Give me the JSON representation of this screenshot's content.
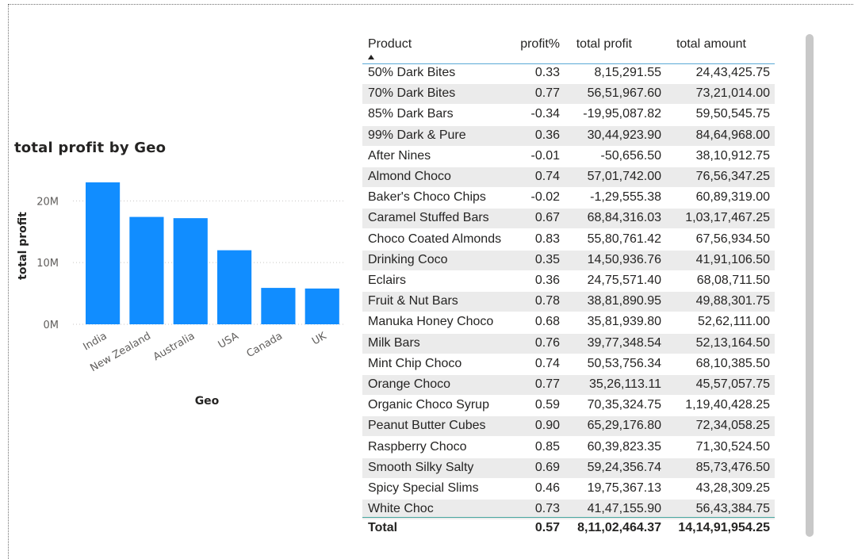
{
  "chart_data": {
    "type": "bar",
    "title": "total profit by Geo",
    "xlabel": "Geo",
    "ylabel": "total profit",
    "categories": [
      "India",
      "New Zealand",
      "Australia",
      "USA",
      "Canada",
      "UK"
    ],
    "values": [
      23000000,
      17400000,
      17200000,
      12000000,
      5900000,
      5800000
    ],
    "ylim": [
      0,
      23000000
    ],
    "yticks": [
      {
        "value": 0,
        "label": "0M"
      },
      {
        "value": 10000000,
        "label": "10M"
      },
      {
        "value": 20000000,
        "label": "20M"
      }
    ],
    "bar_color": "#118dff",
    "grid": true
  },
  "table": {
    "headers": {
      "product": "Product",
      "profit_pct": "profit%",
      "total_profit": "total profit",
      "total_amount": "total amount"
    },
    "sort_indicator": "sort-ascending-icon",
    "rows": [
      {
        "product": "50% Dark Bites",
        "profit_pct": "0.33",
        "total_profit": "8,15,291.55",
        "total_amount": "24,43,425.75"
      },
      {
        "product": "70% Dark Bites",
        "profit_pct": "0.77",
        "total_profit": "56,51,967.60",
        "total_amount": "73,21,014.00"
      },
      {
        "product": "85% Dark Bars",
        "profit_pct": "-0.34",
        "total_profit": "-19,95,087.82",
        "total_amount": "59,50,545.75"
      },
      {
        "product": "99% Dark & Pure",
        "profit_pct": "0.36",
        "total_profit": "30,44,923.90",
        "total_amount": "84,64,968.00"
      },
      {
        "product": "After Nines",
        "profit_pct": "-0.01",
        "total_profit": "-50,656.50",
        "total_amount": "38,10,912.75"
      },
      {
        "product": "Almond Choco",
        "profit_pct": "0.74",
        "total_profit": "57,01,742.00",
        "total_amount": "76,56,347.25"
      },
      {
        "product": "Baker's Choco Chips",
        "profit_pct": "-0.02",
        "total_profit": "-1,29,555.38",
        "total_amount": "60,89,319.00"
      },
      {
        "product": "Caramel Stuffed Bars",
        "profit_pct": "0.67",
        "total_profit": "68,84,316.03",
        "total_amount": "1,03,17,467.25"
      },
      {
        "product": "Choco Coated Almonds",
        "profit_pct": "0.83",
        "total_profit": "55,80,761.42",
        "total_amount": "67,56,934.50"
      },
      {
        "product": "Drinking Coco",
        "profit_pct": "0.35",
        "total_profit": "14,50,936.76",
        "total_amount": "41,91,106.50"
      },
      {
        "product": "Eclairs",
        "profit_pct": "0.36",
        "total_profit": "24,75,571.40",
        "total_amount": "68,08,711.50"
      },
      {
        "product": "Fruit & Nut Bars",
        "profit_pct": "0.78",
        "total_profit": "38,81,890.95",
        "total_amount": "49,88,301.75"
      },
      {
        "product": "Manuka Honey Choco",
        "profit_pct": "0.68",
        "total_profit": "35,81,939.80",
        "total_amount": "52,62,111.00"
      },
      {
        "product": "Milk Bars",
        "profit_pct": "0.76",
        "total_profit": "39,77,348.54",
        "total_amount": "52,13,164.50"
      },
      {
        "product": "Mint Chip Choco",
        "profit_pct": "0.74",
        "total_profit": "50,53,756.34",
        "total_amount": "68,10,385.50"
      },
      {
        "product": "Orange Choco",
        "profit_pct": "0.77",
        "total_profit": "35,26,113.11",
        "total_amount": "45,57,057.75"
      },
      {
        "product": "Organic Choco Syrup",
        "profit_pct": "0.59",
        "total_profit": "70,35,324.75",
        "total_amount": "1,19,40,428.25"
      },
      {
        "product": "Peanut Butter Cubes",
        "profit_pct": "0.90",
        "total_profit": "65,29,176.80",
        "total_amount": "72,34,058.25"
      },
      {
        "product": "Raspberry Choco",
        "profit_pct": "0.85",
        "total_profit": "60,39,823.35",
        "total_amount": "71,30,524.50"
      },
      {
        "product": "Smooth Silky Salty",
        "profit_pct": "0.69",
        "total_profit": "59,24,356.74",
        "total_amount": "85,73,476.50"
      },
      {
        "product": "Spicy Special Slims",
        "profit_pct": "0.46",
        "total_profit": "19,75,367.13",
        "total_amount": "43,28,309.25"
      },
      {
        "product": "White Choc",
        "profit_pct": "0.73",
        "total_profit": "41,47,155.90",
        "total_amount": "56,43,384.75"
      }
    ],
    "total": {
      "label": "Total",
      "profit_pct": "0.57",
      "total_profit": "8,11,02,464.37",
      "total_amount": "14,14,91,954.25"
    }
  }
}
